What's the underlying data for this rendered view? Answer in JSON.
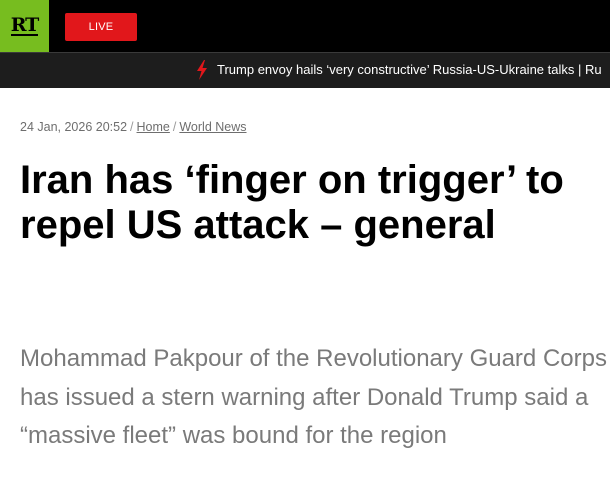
{
  "header": {
    "logo_text": "RT",
    "live_label": "LIVE",
    "colors": {
      "logo_bg": "#77bd1f",
      "live_bg": "#e1171b",
      "bar_bg": "#000000"
    }
  },
  "ticker": {
    "icon": "lightning-bolt-icon",
    "text": "Trump envoy hails ‘very constructive’ Russia-US-Ukraine talks | Ru"
  },
  "breadcrumb": {
    "datetime": "24 Jan, 2026 20:52",
    "home_label": "Home",
    "section_label": "World News",
    "separator": "/"
  },
  "article": {
    "title": "Iran has ‘finger on trigger’ to repel US attack – general",
    "summary": "Mohammad Pakpour of the Revolutionary Guard Corps has issued a stern warning after Donald Trump said a “massive fleet” was bound for the region"
  }
}
